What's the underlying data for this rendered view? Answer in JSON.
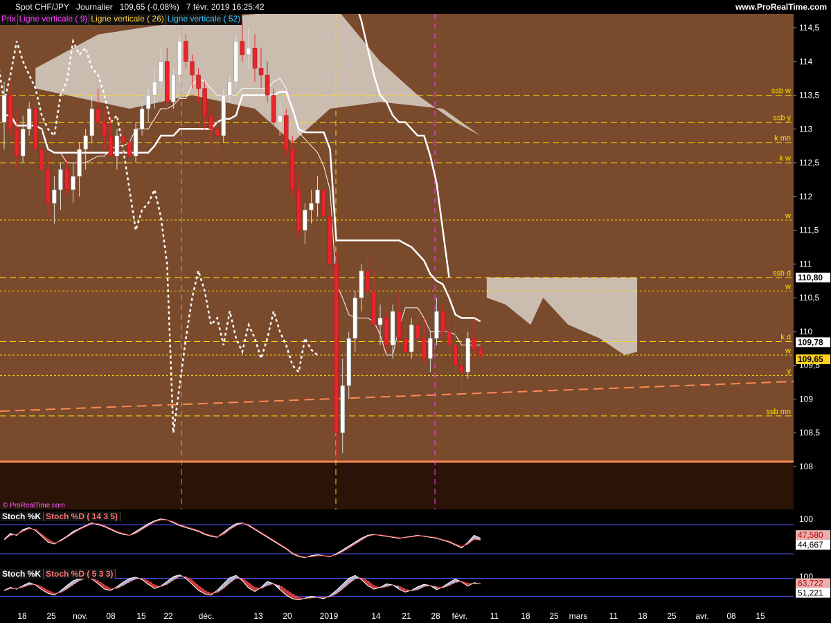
{
  "header": {
    "symbol": "Spot CHF/JPY",
    "period": "Journalier",
    "last": "109,65 (-0,08%)",
    "datetime": "7 févr. 2019 16:25:42",
    "site": "www.ProRealTime.com"
  },
  "legend": {
    "prix": "Prix",
    "lv9": "Ligne verticale ( 9)",
    "lv26": "Ligne verticale ( 26)",
    "lv52": "Ligne verticale ( 52)"
  },
  "credit": "© ProRealTime.com",
  "colors": {
    "bg_main": "#7a4a2c",
    "bg_lower": "#2a1408",
    "bull": "#ffffff",
    "bear": "#e8242c",
    "level": "#ffe000",
    "orange": "#ff8a50",
    "cloud": "#d9d0c8"
  },
  "chart_data": [
    {
      "type": "line",
      "title": "Spot CHF/JPY",
      "period": "Journalier",
      "ylim": [
        107.6,
        114.9
      ],
      "y_ticks": [
        "108",
        "108,5",
        "109",
        "109,5",
        "110",
        "110,5",
        "111",
        "111,5",
        "112",
        "112,5",
        "113",
        "113,5",
        "114",
        "114,5"
      ],
      "x_ticks": [
        "18",
        "25",
        "nov.",
        "08",
        "15",
        "22",
        "déc.",
        "13",
        "20",
        "2019",
        "14",
        "21",
        "28",
        "févr.",
        "11",
        "18",
        "25",
        "mars",
        "11",
        "18",
        "25",
        "avr.",
        "08",
        "15"
      ],
      "last_price_label": "109,65",
      "price_tags": [
        "110,80",
        "109,78",
        "109,65"
      ],
      "levels": [
        {
          "label": "ssb w",
          "value": 113.5
        },
        {
          "label": "ssb y",
          "value": 113.1
        },
        {
          "label": "k mn",
          "value": 112.8
        },
        {
          "label": "k w",
          "value": 112.5
        },
        {
          "label": "w",
          "value": 111.65
        },
        {
          "label": "ssb d",
          "value": 110.8
        },
        {
          "label": "w",
          "value": 110.6
        },
        {
          "label": "k d",
          "value": 109.85
        },
        {
          "label": "w",
          "value": 109.65
        },
        {
          "label": "y",
          "value": 109.35
        },
        {
          "label": "ssb mn",
          "value": 108.75
        }
      ],
      "candles": [
        [
          113.1,
          113.7,
          112.7,
          113.5
        ],
        [
          113.5,
          113.7,
          112.9,
          113.0
        ],
        [
          113.0,
          113.3,
          112.4,
          112.6
        ],
        [
          112.6,
          113.2,
          112.5,
          113.0
        ],
        [
          113.0,
          113.4,
          112.9,
          113.3
        ],
        [
          113.3,
          113.4,
          112.6,
          112.7
        ],
        [
          112.7,
          113.0,
          112.3,
          112.4
        ],
        [
          112.4,
          112.6,
          111.7,
          111.9
        ],
        [
          111.9,
          112.3,
          111.6,
          112.1
        ],
        [
          112.1,
          112.5,
          111.8,
          112.4
        ],
        [
          112.4,
          112.6,
          112.0,
          112.1
        ],
        [
          112.1,
          112.5,
          111.9,
          112.3
        ],
        [
          112.3,
          112.8,
          112.0,
          112.7
        ],
        [
          112.7,
          113.0,
          112.4,
          112.9
        ],
        [
          112.9,
          113.5,
          112.8,
          113.3
        ],
        [
          113.3,
          113.6,
          113.0,
          113.1
        ],
        [
          113.1,
          113.3,
          112.7,
          112.9
        ],
        [
          112.9,
          113.2,
          112.6,
          112.6
        ],
        [
          112.6,
          113.0,
          112.4,
          112.9
        ],
        [
          112.9,
          113.1,
          112.6,
          112.8
        ],
        [
          112.8,
          113.0,
          112.5,
          112.6
        ],
        [
          112.6,
          113.1,
          112.5,
          113.0
        ],
        [
          113.0,
          113.4,
          112.9,
          113.3
        ],
        [
          113.3,
          113.6,
          113.1,
          113.5
        ],
        [
          113.5,
          113.9,
          113.3,
          113.7
        ],
        [
          113.7,
          114.2,
          113.6,
          114.0
        ],
        [
          114.0,
          114.2,
          113.3,
          113.4
        ],
        [
          113.4,
          113.9,
          113.3,
          113.8
        ],
        [
          113.8,
          114.4,
          113.7,
          114.3
        ],
        [
          114.3,
          114.4,
          113.9,
          114.0
        ],
        [
          114.0,
          114.1,
          113.6,
          113.8
        ],
        [
          113.8,
          113.9,
          113.4,
          113.6
        ],
        [
          113.6,
          113.7,
          113.0,
          113.2
        ],
        [
          113.2,
          113.4,
          112.8,
          113.0
        ],
        [
          113.0,
          113.2,
          112.6,
          112.9
        ],
        [
          112.9,
          113.6,
          112.8,
          113.5
        ],
        [
          113.5,
          113.8,
          113.4,
          113.7
        ],
        [
          113.7,
          114.4,
          113.6,
          114.3
        ],
        [
          114.3,
          114.6,
          114.0,
          114.1
        ],
        [
          114.1,
          114.5,
          113.9,
          114.2
        ],
        [
          114.2,
          114.4,
          113.7,
          113.9
        ],
        [
          113.9,
          114.2,
          113.6,
          113.8
        ],
        [
          113.8,
          114.0,
          113.4,
          113.5
        ],
        [
          113.5,
          113.6,
          113.0,
          113.1
        ],
        [
          113.1,
          113.4,
          112.9,
          113.2
        ],
        [
          113.2,
          113.3,
          112.6,
          112.7
        ],
        [
          112.7,
          112.9,
          112.0,
          112.1
        ],
        [
          112.1,
          112.4,
          111.4,
          111.5
        ],
        [
          111.5,
          111.9,
          111.3,
          111.8
        ],
        [
          111.8,
          112.1,
          111.6,
          111.9
        ],
        [
          111.9,
          112.3,
          111.7,
          112.1
        ],
        [
          112.1,
          112.2,
          111.6,
          111.7
        ],
        [
          111.7,
          111.8,
          110.8,
          111.0
        ],
        [
          111.0,
          111.2,
          108.1,
          108.5
        ],
        [
          108.5,
          109.6,
          108.2,
          109.2
        ],
        [
          109.2,
          110.0,
          109.0,
          109.9
        ],
        [
          109.9,
          110.6,
          109.7,
          110.5
        ],
        [
          110.5,
          111.0,
          110.3,
          110.9
        ],
        [
          110.9,
          111.1,
          110.5,
          110.6
        ],
        [
          110.6,
          110.9,
          110.0,
          110.1
        ],
        [
          110.1,
          110.4,
          109.8,
          110.2
        ],
        [
          110.2,
          110.3,
          109.7,
          109.8
        ],
        [
          109.8,
          110.4,
          109.6,
          110.3
        ],
        [
          110.3,
          110.6,
          109.8,
          109.9
        ],
        [
          109.9,
          110.1,
          109.6,
          109.7
        ],
        [
          109.7,
          110.2,
          109.6,
          110.1
        ],
        [
          110.1,
          110.3,
          109.8,
          109.9
        ],
        [
          109.9,
          110.2,
          109.5,
          109.6
        ],
        [
          109.6,
          110.0,
          109.4,
          109.9
        ],
        [
          109.9,
          110.5,
          109.8,
          110.3
        ],
        [
          110.3,
          110.4,
          109.9,
          110.0
        ],
        [
          110.0,
          110.2,
          109.7,
          109.8
        ],
        [
          109.8,
          110.1,
          109.4,
          109.5
        ],
        [
          109.5,
          109.8,
          109.1,
          109.4
        ],
        [
          109.4,
          110.0,
          109.3,
          109.9
        ],
        [
          109.9,
          110.2,
          109.6,
          109.73
        ],
        [
          109.73,
          109.8,
          109.6,
          109.65
        ]
      ]
    },
    {
      "type": "line",
      "title": "Stoch %K / Stoch %D ( 14 3 5)",
      "series": [
        {
          "name": "Stoch %K",
          "values": [
            50,
            62,
            58,
            70,
            74,
            68,
            56,
            44,
            40,
            48,
            56,
            66,
            72,
            78,
            84,
            80,
            76,
            70,
            64,
            60,
            58,
            66,
            74,
            82,
            88,
            92,
            90,
            84,
            78,
            74,
            70,
            66,
            60,
            56,
            54,
            64,
            74,
            82,
            84,
            78,
            70,
            62,
            54,
            46,
            38,
            30,
            20,
            14,
            12,
            16,
            18,
            16,
            14,
            20,
            28,
            36,
            44,
            52,
            58,
            60,
            58,
            56,
            54,
            52,
            54,
            56,
            58,
            56,
            54,
            52,
            48,
            44,
            38,
            32,
            44,
            58,
            52
          ]
        },
        {
          "name": "Stoch %D",
          "values": [
            48,
            58,
            60,
            66,
            72,
            70,
            60,
            50,
            42,
            46,
            54,
            62,
            70,
            76,
            82,
            82,
            78,
            72,
            66,
            62,
            58,
            62,
            70,
            78,
            86,
            90,
            90,
            86,
            80,
            76,
            72,
            68,
            62,
            58,
            55,
            60,
            70,
            78,
            83,
            80,
            72,
            64,
            56,
            48,
            40,
            32,
            22,
            16,
            13,
            14,
            16,
            16,
            15,
            18,
            24,
            32,
            40,
            48,
            56,
            59,
            59,
            57,
            55,
            53,
            53,
            55,
            57,
            57,
            55,
            53,
            49,
            46,
            40,
            35,
            40,
            50,
            48
          ]
        }
      ],
      "y_ticks": [
        "100"
      ],
      "value_tags": [
        "47,580",
        "44,667"
      ]
    },
    {
      "type": "line",
      "title": "Stoch %K / Stoch %D ( 5 3 3)",
      "series": [
        {
          "name": "Stoch %K",
          "values": [
            40,
            50,
            44,
            56,
            66,
            58,
            42,
            30,
            24,
            38,
            56,
            72,
            80,
            86,
            78,
            62,
            44,
            40,
            52,
            68,
            80,
            84,
            76,
            60,
            46,
            54,
            70,
            86,
            92,
            80,
            60,
            40,
            28,
            24,
            40,
            62,
            82,
            90,
            72,
            48,
            36,
            50,
            70,
            62,
            42,
            24,
            12,
            8,
            14,
            20,
            16,
            12,
            22,
            40,
            60,
            80,
            90,
            76,
            56,
            44,
            50,
            62,
            58,
            44,
            34,
            40,
            52,
            60,
            56,
            42,
            52,
            66,
            78,
            68,
            54,
            66,
            61
          ]
        },
        {
          "name": "Stoch %D",
          "values": [
            38,
            46,
            46,
            50,
            58,
            60,
            52,
            40,
            30,
            32,
            44,
            58,
            72,
            80,
            80,
            72,
            58,
            46,
            46,
            56,
            68,
            78,
            80,
            72,
            58,
            52,
            60,
            74,
            86,
            86,
            74,
            56,
            40,
            30,
            32,
            46,
            64,
            80,
            80,
            66,
            50,
            46,
            56,
            62,
            56,
            42,
            28,
            16,
            12,
            14,
            16,
            16,
            18,
            28,
            44,
            62,
            78,
            82,
            72,
            56,
            48,
            52,
            58,
            54,
            44,
            38,
            42,
            52,
            56,
            52,
            48,
            56,
            66,
            70,
            64,
            62,
            63
          ]
        }
      ],
      "y_ticks": [
        "100"
      ],
      "value_tags": [
        "63,722",
        "51,221"
      ]
    }
  ]
}
